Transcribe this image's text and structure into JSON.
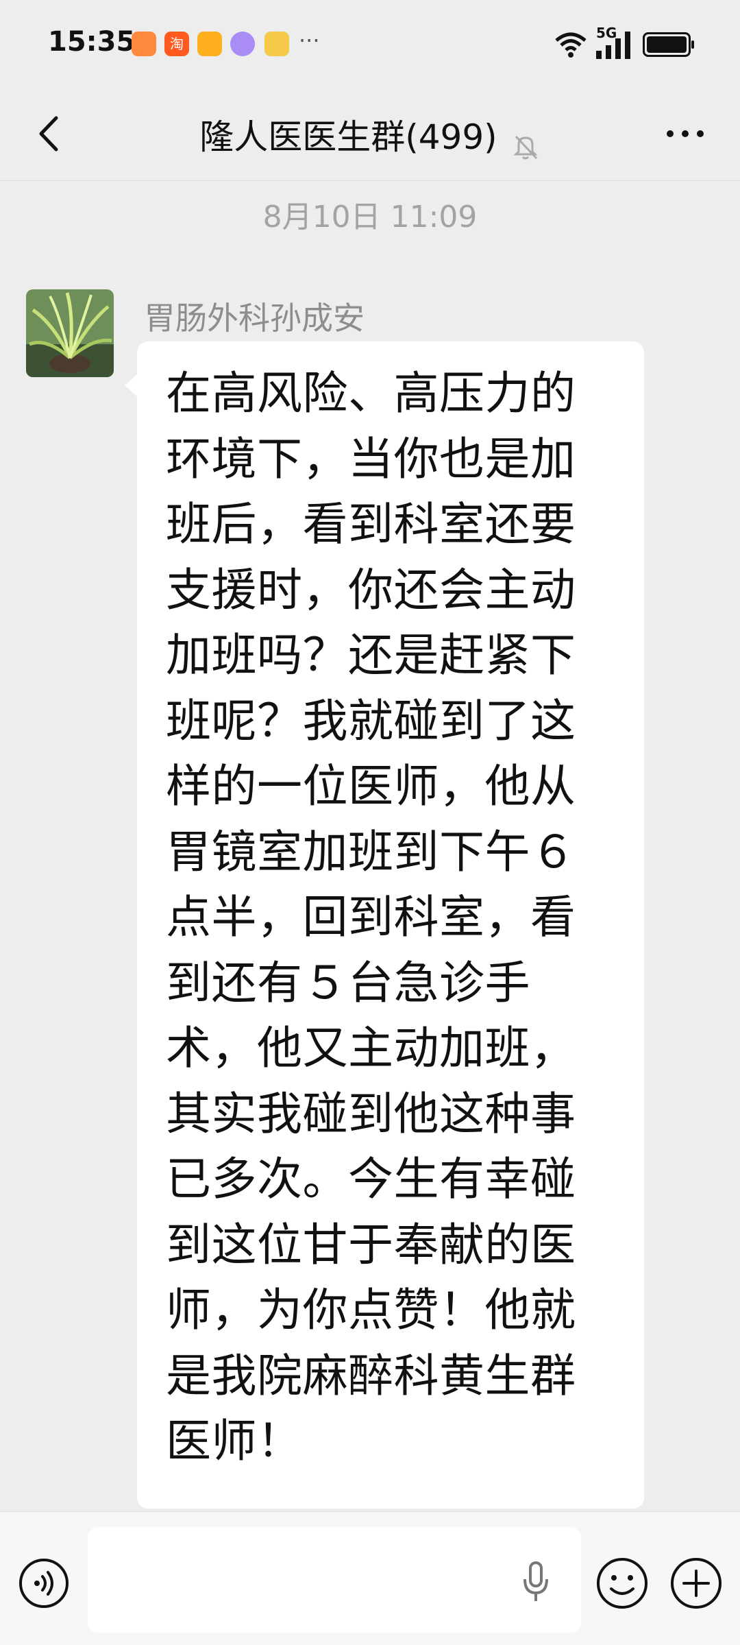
{
  "status_bar": {
    "time": "15:35",
    "notification_icons": [
      "wallet-icon",
      "taobao-icon",
      "wallet-icon",
      "chat-app-icon",
      "card-icon"
    ],
    "more_indicator": "···",
    "network_label": "5G",
    "signal_icon": "signal-icon",
    "wifi_icon": "wifi-icon",
    "battery_icon": "battery-icon"
  },
  "header": {
    "title": "隆人医医生群(499)",
    "back_icon": "back-icon",
    "mute_icon": "bell-muted-icon",
    "more_icon": "more-icon"
  },
  "chat": {
    "timestamp": "8月10日 11:09",
    "messages": [
      {
        "sender": "胃肠外科孙成安",
        "avatar": "plant-photo-avatar",
        "text": "在高风险、高压力的环境下，当你也是加班后，看到科室还要支援时，你还会主动加班吗？还是赶紧下班呢？我就碰到了这样的一位医师，他从胃镜室加班到下午６点半，回到科室，看到还有５台急诊手术，他又主动加班，其实我碰到他这种事已多次。今生有幸碰到这位甘于奉献的医师，为你点赞！他就是我院麻醉科黄生群医师！"
      }
    ]
  },
  "input_bar": {
    "placeholder": "",
    "voice_icon": "voice-icon",
    "mic_icon": "mic-icon",
    "emoji_icon": "emoji-icon",
    "plus_icon": "plus-icon"
  },
  "colors": {
    "background": "#ededed",
    "bubble": "#ffffff",
    "sender": "#8d8d8d",
    "timestamp": "#a3a3a3"
  }
}
